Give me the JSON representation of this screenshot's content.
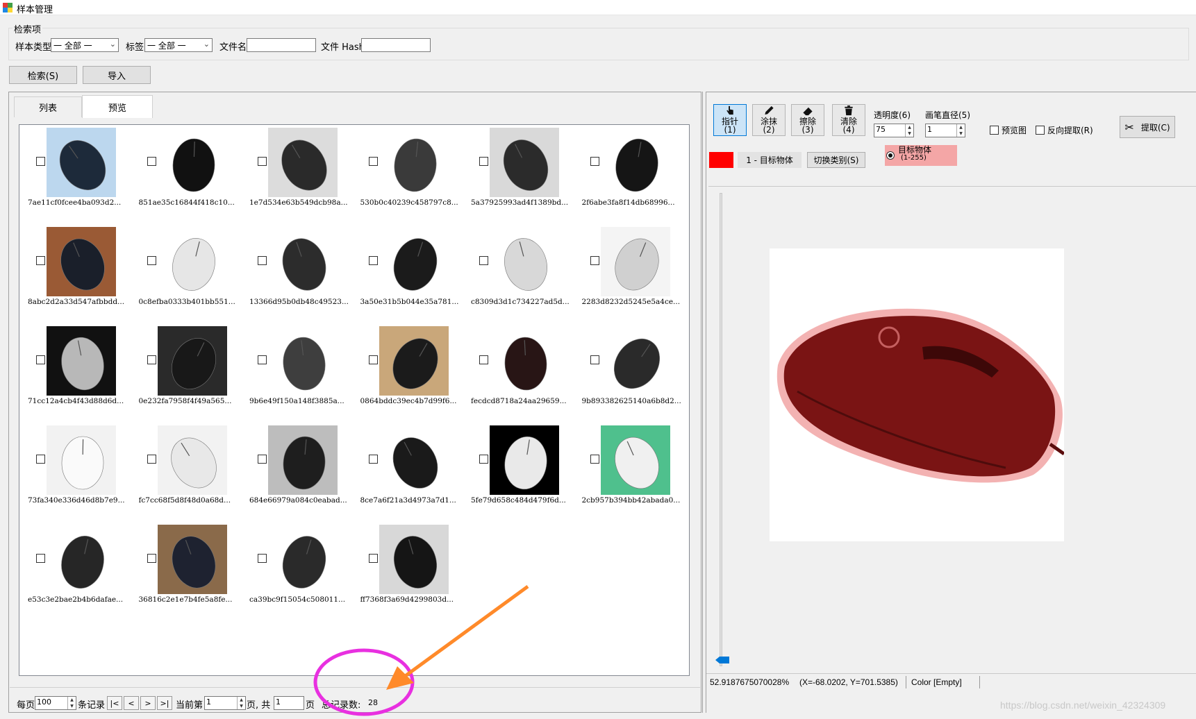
{
  "window": {
    "title": "样本管理"
  },
  "search": {
    "group_label": "检索项",
    "sample_type_label": "样本类型",
    "sample_type_value": "一 全部 一",
    "tag_label": "标签",
    "tag_value": "一 全部 一",
    "filename_label": "文件名",
    "filename_value": "",
    "hash_label": "文件 Hash",
    "hash_value": "",
    "search_button": "检索(S)",
    "import_button": "导入"
  },
  "tabs": [
    {
      "label": "列表",
      "active": false
    },
    {
      "label": "预览",
      "active": true
    }
  ],
  "thumbnails": [
    {
      "name": "7ae11cf0fcee4ba093d2...",
      "bg": "#bcd7ee",
      "body": "#1d2a3a"
    },
    {
      "name": "851ae35c16844f418c10...",
      "bg": "#ffffff",
      "body": "#111111"
    },
    {
      "name": "1e7d534e63b549dcb98a...",
      "bg": "#dcdcdc",
      "body": "#2a2a2a"
    },
    {
      "name": "530b0c40239c458797c8...",
      "bg": "#ffffff",
      "body": "#3a3a3a"
    },
    {
      "name": "5a37925993ad4f1389bd...",
      "bg": "#d9d9d9",
      "body": "#2b2b2b"
    },
    {
      "name": "2f6abe3fa8f14db68996...",
      "bg": "#ffffff",
      "body": "#151515"
    },
    {
      "name": "8abc2d2a33d547afbbdd...",
      "bg": "#9a5a35",
      "body": "#1a1f2a"
    },
    {
      "name": "0c8efba0333b401bb551...",
      "bg": "#ffffff",
      "body": "#e6e6e6"
    },
    {
      "name": "13366d95b0db48c49523...",
      "bg": "#ffffff",
      "body": "#2c2c2c"
    },
    {
      "name": "3a50e31b5b044e35a781...",
      "bg": "#ffffff",
      "body": "#1b1b1b"
    },
    {
      "name": "c8309d3d1c734227ad5d...",
      "bg": "#ffffff",
      "body": "#d8d8d8"
    },
    {
      "name": "2283d8232d5245e5a4ce...",
      "bg": "#f4f4f4",
      "body": "#d0d0d0"
    },
    {
      "name": "71cc12a4cb4f43d88d6d...",
      "bg": "#111111",
      "body": "#b8b8b8"
    },
    {
      "name": "0e232fa7958f4f49a565...",
      "bg": "#2a2a2a",
      "body": "#181818"
    },
    {
      "name": "9b6e49f150a148f3885a...",
      "bg": "#ffffff",
      "body": "#3e3e3e"
    },
    {
      "name": "0864bddc39ec4b7d99f6...",
      "bg": "#c9a77a",
      "body": "#1b1b1b"
    },
    {
      "name": "fecdcd8718a24aa29659...",
      "bg": "#ffffff",
      "body": "#281515"
    },
    {
      "name": "9b893382625140a6b8d2...",
      "bg": "#ffffff",
      "body": "#2a2a2a"
    },
    {
      "name": "73fa340e336d46d8b7e9...",
      "bg": "#f2f2f2",
      "body": "#fafafa"
    },
    {
      "name": "fc7cc68f5d8f48d0a68d...",
      "bg": "#f2f2f2",
      "body": "#e8e8e8"
    },
    {
      "name": "684e66979a084c0eabad...",
      "bg": "#bdbdbd",
      "body": "#1e1e1e"
    },
    {
      "name": "8ce7a6f21a3d4973a7d1...",
      "bg": "#ffffff",
      "body": "#1a1a1a"
    },
    {
      "name": "5fe79d658c484d479f6d...",
      "bg": "#000000",
      "body": "#e9e9e9"
    },
    {
      "name": "2cb957b394bb42abada0...",
      "bg": "#4fc08d",
      "body": "#f0f0f0"
    },
    {
      "name": "e53c3e2bae2b4b6dafae...",
      "bg": "#ffffff",
      "body": "#262626"
    },
    {
      "name": "36816c2e1e7b4fe5a8fe...",
      "bg": "#8a6a4a",
      "body": "#1e2230"
    },
    {
      "name": "ca39bc9f15054c508011...",
      "bg": "#ffffff",
      "body": "#2a2a2a"
    },
    {
      "name": "ff7368f3a69d4299803d...",
      "bg": "#d8d8d8",
      "body": "#151515"
    }
  ],
  "pager": {
    "per_page_label": "每页",
    "per_page_value": "100",
    "records_label": "条记录",
    "first": "|<",
    "prev": "<",
    "next": ">",
    "last": ">|",
    "current_label": "当前第",
    "current_value": "1",
    "page_total_label": "页, 共",
    "total_pages": "1",
    "page_suffix": "页",
    "total_records_label": "总记录数:",
    "total_records": "28"
  },
  "toolbar": {
    "pointer_label": "指针",
    "pointer_key": "(1)",
    "brush_label": "涂抹",
    "brush_key": "(2)",
    "eraser_label": "擦除",
    "eraser_key": "(3)",
    "clear_label": "清除",
    "clear_key": "(4)",
    "opacity_label": "透明度(6)",
    "opacity_value": "75",
    "pen_size_label": "画笔直径(5)",
    "pen_size_value": "1",
    "preview_label": "预览图",
    "reverse_label": "反向提取(R)",
    "extract_label": "提取(C)",
    "class_label": "1 - 目标物体",
    "switch_class_label": "切换类别(S)",
    "target_radio_label": "目标物体",
    "target_radio_range": "(1-255)",
    "class_color": "#ff0000",
    "target_highlight": "#f4a6a6"
  },
  "status": {
    "zoom": "52.9187675070028%",
    "coords": "(X=-68.0202, Y=701.5385)",
    "color": "Color [Empty]"
  },
  "watermark": "https://blog.csdn.net/weixin_42324309",
  "annotation": {
    "circle_color": "#e830e0",
    "arrow_color": "#ff8a2a"
  }
}
